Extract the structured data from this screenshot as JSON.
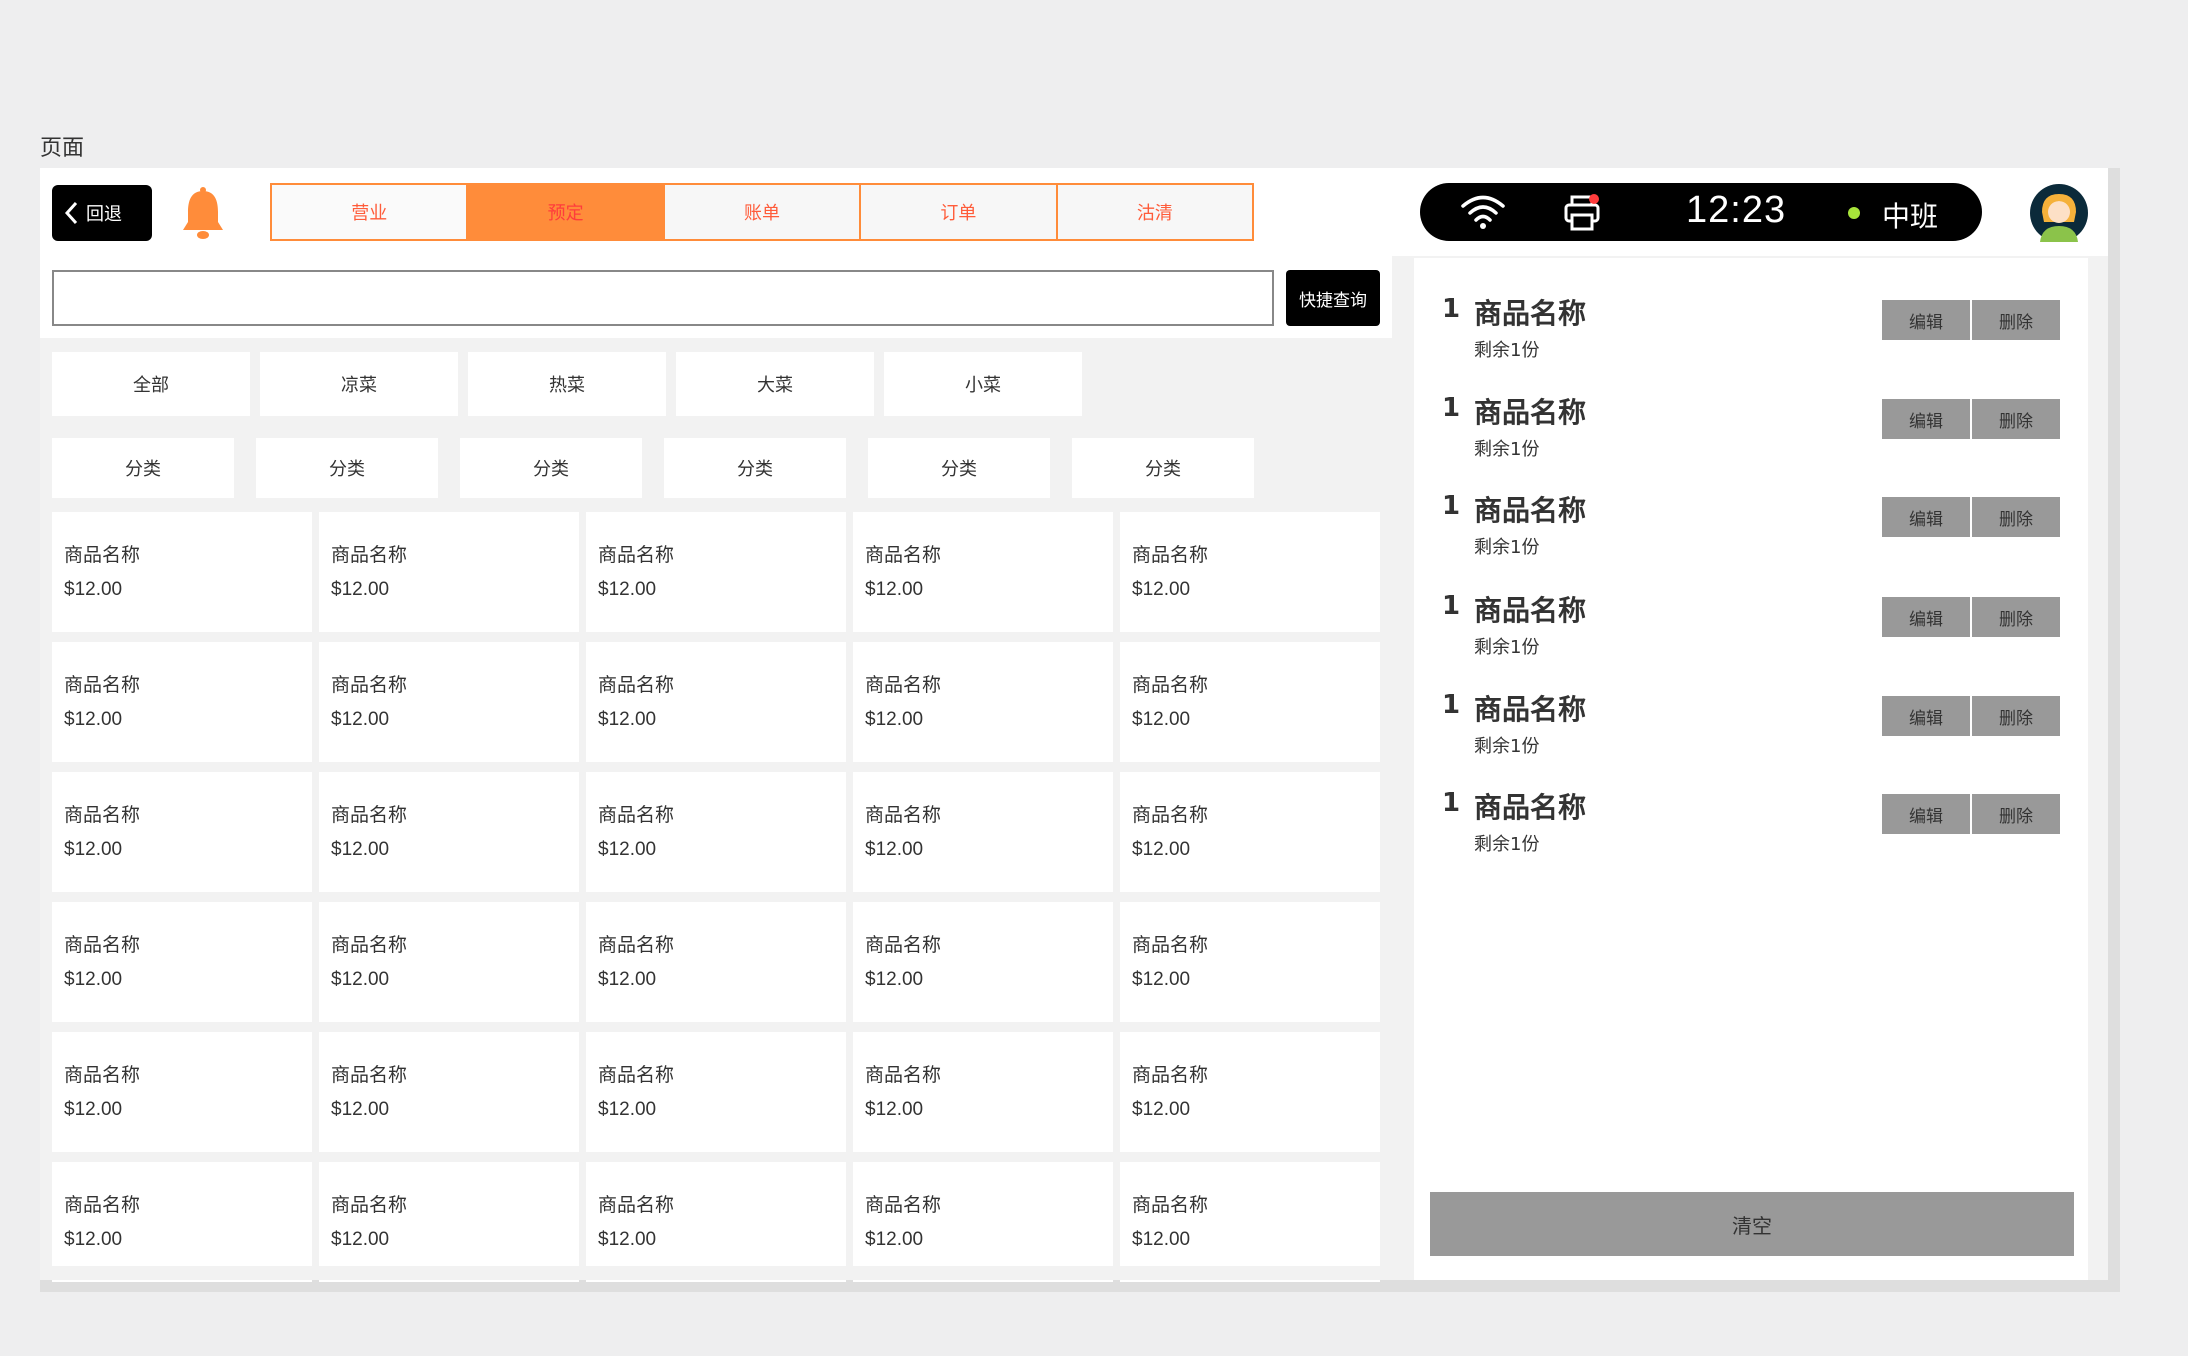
{
  "page_label": "页面",
  "header": {
    "back_label": "回退",
    "tabs": [
      {
        "label": "营业"
      },
      {
        "label": "预定"
      },
      {
        "label": "账单"
      },
      {
        "label": "订单"
      },
      {
        "label": "沽清"
      }
    ],
    "active_tab": "预定",
    "status": {
      "time": "12:23",
      "shift": "中班"
    },
    "accent_color": "#ff8c3a"
  },
  "search": {
    "value": "",
    "button_label": "快捷查询"
  },
  "categories": [
    "全部",
    "凉菜",
    "热菜",
    "大菜",
    "小菜"
  ],
  "subcategories": [
    "分类",
    "分类",
    "分类",
    "分类",
    "分类",
    "分类"
  ],
  "products": [
    {
      "name": "商品名称",
      "price": "$12.00"
    },
    {
      "name": "商品名称",
      "price": "$12.00"
    },
    {
      "name": "商品名称",
      "price": "$12.00"
    },
    {
      "name": "商品名称",
      "price": "$12.00"
    },
    {
      "name": "商品名称",
      "price": "$12.00"
    },
    {
      "name": "商品名称",
      "price": "$12.00"
    },
    {
      "name": "商品名称",
      "price": "$12.00"
    },
    {
      "name": "商品名称",
      "price": "$12.00"
    },
    {
      "name": "商品名称",
      "price": "$12.00"
    },
    {
      "name": "商品名称",
      "price": "$12.00"
    },
    {
      "name": "商品名称",
      "price": "$12.00"
    },
    {
      "name": "商品名称",
      "price": "$12.00"
    },
    {
      "name": "商品名称",
      "price": "$12.00"
    },
    {
      "name": "商品名称",
      "price": "$12.00"
    },
    {
      "name": "商品名称",
      "price": "$12.00"
    },
    {
      "name": "商品名称",
      "price": "$12.00"
    },
    {
      "name": "商品名称",
      "price": "$12.00"
    },
    {
      "name": "商品名称",
      "price": "$12.00"
    },
    {
      "name": "商品名称",
      "price": "$12.00"
    },
    {
      "name": "商品名称",
      "price": "$12.00"
    },
    {
      "name": "商品名称",
      "price": "$12.00"
    },
    {
      "name": "商品名称",
      "price": "$12.00"
    },
    {
      "name": "商品名称",
      "price": "$12.00"
    },
    {
      "name": "商品名称",
      "price": "$12.00"
    },
    {
      "name": "商品名称",
      "price": "$12.00"
    },
    {
      "name": "商品名称",
      "price": "$12.00"
    },
    {
      "name": "商品名称",
      "price": "$12.00"
    },
    {
      "name": "商品名称",
      "price": "$12.00"
    },
    {
      "name": "商品名称",
      "price": "$12.00"
    },
    {
      "name": "商品名称",
      "price": "$12.00"
    }
  ],
  "order": {
    "items": [
      {
        "qty": "1",
        "name": "商品名称",
        "remain": "剩余1份",
        "edit": "编辑",
        "delete": "删除"
      },
      {
        "qty": "1",
        "name": "商品名称",
        "remain": "剩余1份",
        "edit": "编辑",
        "delete": "删除"
      },
      {
        "qty": "1",
        "name": "商品名称",
        "remain": "剩余1份",
        "edit": "编辑",
        "delete": "删除"
      },
      {
        "qty": "1",
        "name": "商品名称",
        "remain": "剩余1份",
        "edit": "编辑",
        "delete": "删除"
      },
      {
        "qty": "1",
        "name": "商品名称",
        "remain": "剩余1份",
        "edit": "编辑",
        "delete": "删除"
      },
      {
        "qty": "1",
        "name": "商品名称",
        "remain": "剩余1份",
        "edit": "编辑",
        "delete": "删除"
      }
    ],
    "clear_label": "清空"
  }
}
